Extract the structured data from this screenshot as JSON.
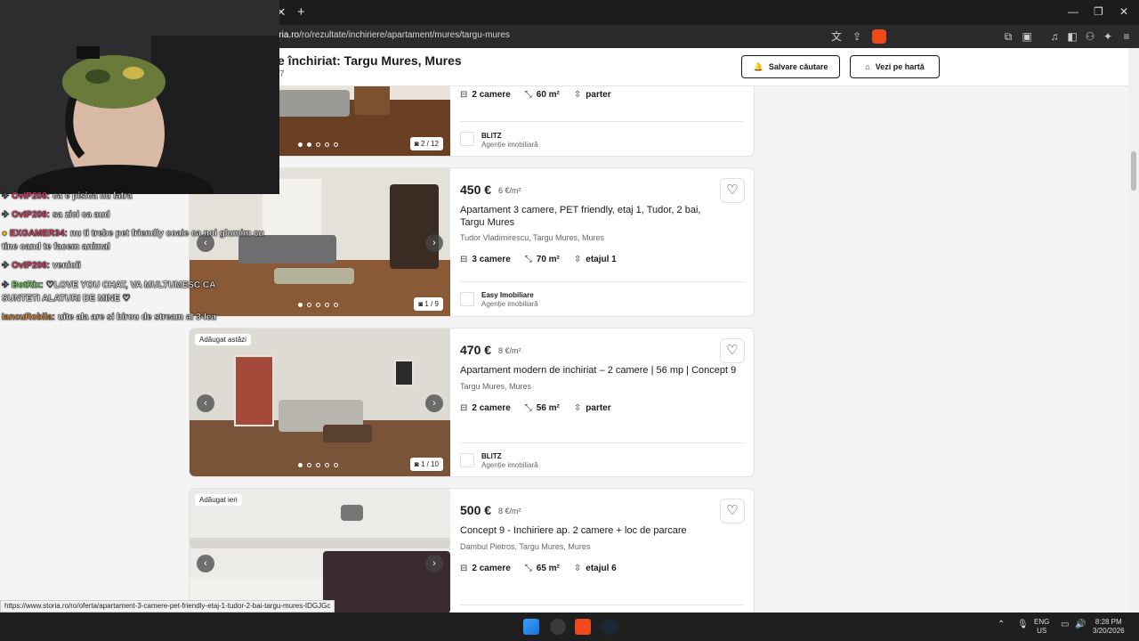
{
  "browser": {
    "url_prefix": "storia.ro",
    "url_path": "/ro/rezultate/inchiriere/apartament/mures/targu-mures",
    "status_url": "https://www.storia.ro/ro/oferta/apartament-3-camere-pet-friendly-etaj-1-tudor-2-bai-targu-mures-IDGJGc"
  },
  "page": {
    "title": "e închiriat: Targu Mures, Mures",
    "subtitle": "7",
    "save_search_label": "Salvare căutare",
    "map_view_label": "Vezi pe hartă"
  },
  "listings": [
    {
      "rooms": "2 camere",
      "area": "60 m²",
      "floor": "parter",
      "counter": "2 / 12",
      "agency_name": "BLITZ",
      "agency_type": "Agenție imobiliară"
    },
    {
      "price": "450 €",
      "price_m2": "6 €/m²",
      "title": "Apartament 3 camere, PET friendly, etaj 1, Tudor, 2 bai, Targu Mures",
      "address": "Tudor Vladimirescu, Targu Mures, Mures",
      "rooms": "3 camere",
      "area": "70 m²",
      "floor": "etajul 1",
      "counter": "1 / 9",
      "agency_name": "Easy Imobiliare",
      "agency_type": "Agenție imobiliară"
    },
    {
      "badge": "Adăugat astăzi",
      "price": "470 €",
      "price_m2": "8 €/m²",
      "title": "Apartament modern de inchiriat – 2 camere | 56 mp | Concept 9",
      "address": "Targu Mures, Mures",
      "rooms": "2 camere",
      "area": "56 m²",
      "floor": "parter",
      "counter": "1 / 10",
      "agency_name": "BLITZ",
      "agency_type": "Agenție imobiliară"
    },
    {
      "badge": "Adăugat ieri",
      "price": "500 €",
      "price_m2": "8 €/m²",
      "title": "Concept 9 - Inchiriere ap. 2 camere + loc de parcare",
      "address": "Dambul Pietros, Targu Mures, Mures",
      "rooms": "2 camere",
      "area": "65 m²",
      "floor": "etajul 6"
    }
  ],
  "chat": [
    {
      "user": "OvIP206:",
      "text": "ca e pisica nu latra",
      "color": "#ff3b6b"
    },
    {
      "user": "OvIP206:",
      "text": "sa zici ca aud",
      "color": "#ff3b6b"
    },
    {
      "user": "EXGAMER34:",
      "text": "nu ti trebe pet friendly coaie ca noi glumim cu",
      "text2": "tine cand te facem animal",
      "color": "#ff3b6b"
    },
    {
      "user": "OvIP206:",
      "text": "venioii",
      "color": "#ff3b6b"
    },
    {
      "user": "BotRix:",
      "text": "♡LOVE YOU CHAT, VA MULTUMESC CA",
      "text2": "SUNTETI ALATURI DE MINE ♡",
      "color": "#7cff6b"
    },
    {
      "user": "IancuRobila:",
      "text": "uite ala are si birou de stream al 3-lea",
      "color": "#ff9a3b"
    }
  ],
  "tray": {
    "lang": "ENG",
    "region": "US",
    "time": "8:28 PM",
    "date": "3/20/2026"
  },
  "icons": {
    "heart": "♡",
    "camera": "📷",
    "chevron_left": "‹",
    "chevron_right": "›",
    "rooms": "⊟",
    "area": "⤡",
    "floor": "⇳",
    "bell": "🔔",
    "pin": "⌂"
  }
}
